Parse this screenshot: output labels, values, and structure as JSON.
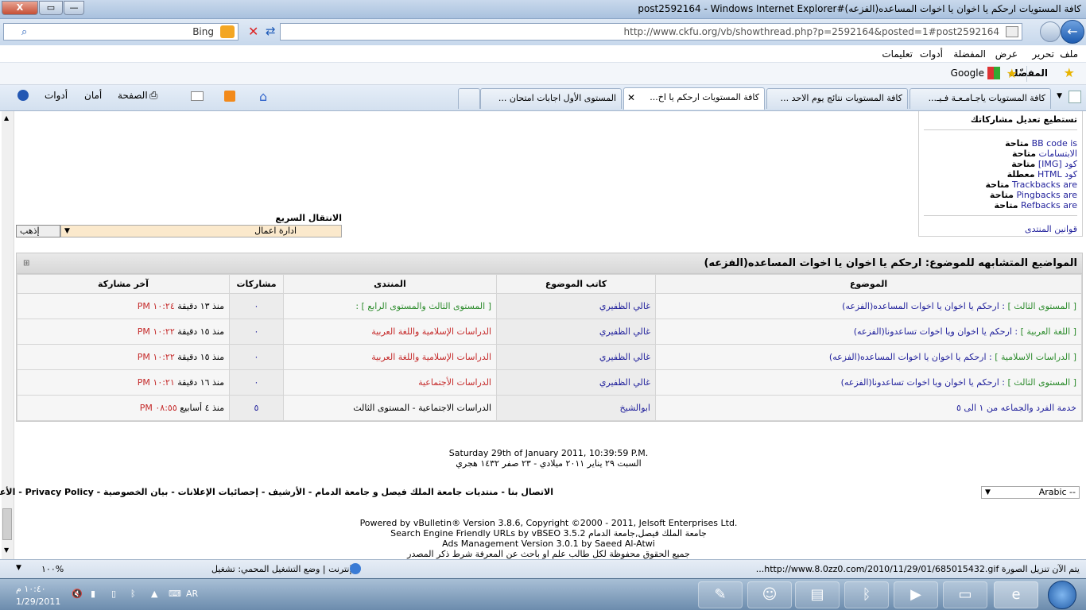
{
  "window": {
    "title": "كافة المستويات ارحكم يا اخوان يا اخوات المساعده(الفزعه)#post2592164 - Windows Internet Explorer",
    "close": "X",
    "max": "▭",
    "min": "—"
  },
  "address": {
    "url": "http://www.ckfu.org/vb/showthread.php?p=2592164&posted=1#post2592164",
    "search_placeholder": "Bing"
  },
  "menu": [
    "ملف",
    "تحرير",
    "عرض",
    "المفضلة",
    "أدوات",
    "تعليمات"
  ],
  "favorites": {
    "label": "المفضّلة",
    "google": "Google"
  },
  "tabs": [
    "كافة المستويات ياجـامـعـة فـيـ...",
    "كافة المستويات نتائج يوم الاحد ...",
    "كافة المستويات ارحكم يا اخ...",
    "المستوى الأول اجابات امتحان ..."
  ],
  "toolbar": {
    "page": "الصفحة",
    "safety": "أمان",
    "tools": "أدوات"
  },
  "perms": {
    "top": "تستطيع تعديل مشاركاتك",
    "rows": [
      {
        "label": "BB code is",
        "state": "متاحة"
      },
      {
        "label": "الابتسامات",
        "state": "متاحة"
      },
      {
        "label": "كود [IMG]",
        "state": "متاحة"
      },
      {
        "label": "كود HTML",
        "state": "معطلة"
      },
      {
        "label": "Trackbacks are",
        "state": "متاحة"
      },
      {
        "label": "Pingbacks are",
        "state": "متاحة"
      },
      {
        "label": "Refbacks are",
        "state": "متاحة"
      }
    ],
    "rules": "قوانين المنتدى"
  },
  "quick": {
    "label": "الانتقال السريع",
    "selected": "ادارة اعمال",
    "go": "إذهب"
  },
  "similar": {
    "title": "المواضيع المتشابهه للموضوع: ارحكم يا اخوان يا اخوات المساعده(الفزعه)",
    "headers": [
      "الموضوع",
      "كاتب الموضوع",
      "المنتدى",
      "مشاركات",
      "آخر مشاركة"
    ],
    "rows": [
      {
        "prefix": "[ المستوى الثالث ]",
        "topic": ": ارحكم يا اخوان يا اخوات المساعده(الفزعه)",
        "author": "غالي الظفيري",
        "forum": "[ المستوى الثالث والمستوى الرابع ] :",
        "replies": "٠",
        "ago": "منذ ١٣ دقيقة",
        "time": "١٠:٢٤ PM"
      },
      {
        "prefix": "[ اللغة العربية ]",
        "topic": ": ارحكم يا اخوان ويا اخوات تساعدونا(الفزعه)",
        "author": "غالي الظفيري",
        "forum": "الدراسات الإسلامية واللغة العربية",
        "replies": "٠",
        "ago": "منذ ١٥ دقيقة",
        "time": "١٠:٢٢ PM"
      },
      {
        "prefix": "[ الدراسات الاسلامية ]",
        "topic": ": ارحكم يا اخوان يا اخوات المساعده(الفزعه)",
        "author": "غالي الظفيري",
        "forum": "الدراسات الإسلامية واللغة العربية",
        "replies": "٠",
        "ago": "منذ ١٥ دقيقة",
        "time": "١٠:٢٢ PM"
      },
      {
        "prefix": "[ المستوى الثالث ]",
        "topic": ": ارحكم يا اخوان ويا اخوات تساعدونا(الفزعه)",
        "author": "غالي الظفيري",
        "forum": "الدراسات الأجتماعية",
        "replies": "٠",
        "ago": "منذ ١٦ دقيقة",
        "time": "١٠:٢١ PM"
      },
      {
        "prefix": "",
        "topic": "خدمة الفرد والجماعه من ١ الى ٥",
        "author": "ابوالشيخ",
        "forum": "الدراسات الاجتماعية - المستوى الثالث",
        "replies": "٥",
        "ago": "منذ ٤ أسابيع",
        "time": "٠٨:٥٥ PM"
      }
    ]
  },
  "datetime": {
    "en": "Saturday 29th of January 2011, 10:39:59 P.M.",
    "ar": "السبت ٢٩ يناير ٢٠١١ ميلادي - ٢٣ صفر ١٤٣٢ هجري"
  },
  "footer": {
    "links": "الاتصال بنا - منتديات جامعة الملك فيصل و جامعة الدمام - الأرشيف - إحصائيات الإعلانات - بيان الخصوصية - Privacy Policy - الأعلى",
    "lang": "Arabic --"
  },
  "copyright": [
    "Powered by vBulletin® Version 3.8.6, Copyright ©2000 - 2011, Jelsoft Enterprises Ltd.",
    "Search Engine Friendly URLs by vBSEO 3.5.2 جامعة الملك فيصل,جامعة الدمام",
    "Ads Management Version 3.0.1 by Saeed Al-Atwi",
    "جميع الحقوق محفوظة لكل طالب علم او باحث عن المعرفة شرط ذكر المصدر"
  ],
  "status": {
    "left": "يتم الآن تنزيل الصورة http://www.8.0zz0.com/2010/11/29/01/685015432.gif...",
    "zone": "إنترنت | وضع التشغيل المحمي: تشغيل",
    "zoom": "١٠٠%"
  },
  "tray": {
    "time": "١٠:٤٠ م",
    "date": "1/29/2011",
    "lang": "AR"
  }
}
